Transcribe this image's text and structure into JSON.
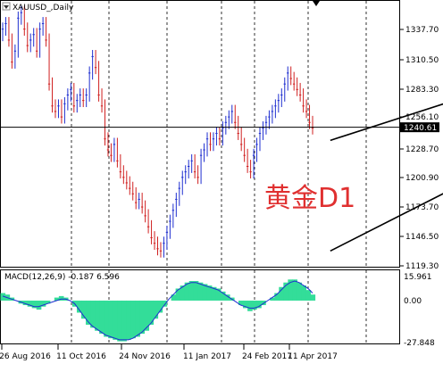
{
  "chart": {
    "symbol_label": "XAUUSD_,Daily",
    "annotation": "黄金D1",
    "current_price": "1240.61",
    "price_axis": [
      "1337.70",
      "1310.50",
      "1283.30",
      "1256.10",
      "1228.70",
      "1200.90",
      "1173.70",
      "1146.50",
      "1119.30"
    ],
    "time_axis": [
      "26 Aug 2016",
      "11 Oct 2016",
      "24 Nov 2016",
      "11 Jan 2017",
      "24 Feb 2017",
      "11 Apr 2017"
    ],
    "macd_label": "MACD(12,26,9) -0.187 6.596",
    "macd_axis": [
      "15.961",
      "0.00",
      "-27.848"
    ],
    "colors": {
      "background": "#ffffff",
      "candles": "#1f2fd0",
      "candles_bear": "#d02020",
      "annotation": "#e03030",
      "macd_histogram": "#33dd99",
      "macd_signal": "#1f2fd0",
      "grid": "#000000"
    }
  },
  "chart_data": {
    "type": "candlestick",
    "instrument": "XAUUSD",
    "timeframe": "Daily",
    "ylim": [
      1119.3,
      1350
    ],
    "x_start": "2016-07-20",
    "close": [
      1330,
      1335,
      1320,
      1300,
      1310,
      1340,
      1345,
      1330,
      1315,
      1320,
      1325,
      1310,
      1330,
      1335,
      1320,
      1280,
      1260,
      1255,
      1260,
      1250,
      1262,
      1270,
      1275,
      1260,
      1265,
      1270,
      1265,
      1270,
      1290,
      1305,
      1295,
      1270,
      1260,
      1230,
      1220,
      1215,
      1225,
      1210,
      1200,
      1195,
      1190,
      1185,
      1180,
      1172,
      1175,
      1168,
      1160,
      1150,
      1140,
      1135,
      1130,
      1128,
      1135,
      1145,
      1155,
      1165,
      1175,
      1185,
      1195,
      1200,
      1205,
      1210,
      1200,
      1195,
      1215,
      1220,
      1230,
      1225,
      1230,
      1235,
      1230,
      1240,
      1245,
      1250,
      1255,
      1245,
      1235,
      1225,
      1215,
      1205,
      1200,
      1215,
      1225,
      1235,
      1240,
      1245,
      1250,
      1255,
      1260,
      1265,
      1270,
      1280,
      1290,
      1285,
      1280,
      1275,
      1270,
      1260,
      1255,
      1245,
      1240
    ],
    "trend_lines": [
      {
        "name": "channel-upper",
        "from": [
          "2016-12-15",
          1228.7
        ],
        "to": [
          "2017-04-20",
          1310.5
        ]
      },
      {
        "name": "channel-lower",
        "from": [
          "2016-12-15",
          1128.0
        ],
        "to": [
          "2017-04-25",
          1262.0
        ]
      }
    ],
    "horizontal_lines": [
      {
        "name": "current-price-line",
        "y": 1240.61
      }
    ],
    "macd": {
      "params": [
        12,
        26,
        9
      ],
      "value": -0.187,
      "signal": 6.596,
      "ylim": [
        -27.848,
        15.961
      ],
      "histogram": [
        5,
        4,
        2,
        0,
        -2,
        -3,
        -4,
        -5,
        -6,
        -4,
        -2,
        0,
        2,
        3,
        2,
        0,
        -4,
        -8,
        -12,
        -16,
        -18,
        -20,
        -22,
        -24,
        -25,
        -26,
        -27,
        -27,
        -26,
        -25,
        -24,
        -22,
        -20,
        -16,
        -12,
        -8,
        -4,
        0,
        4,
        8,
        10,
        12,
        13,
        13,
        12,
        11,
        10,
        9,
        8,
        6,
        4,
        2,
        0,
        -3,
        -5,
        -7,
        -6,
        -5,
        -3,
        0,
        2,
        5,
        9,
        12,
        14,
        14,
        12,
        10,
        7,
        4
      ],
      "signal_line": [
        3,
        2,
        1,
        0,
        -1,
        -2,
        -3,
        -4,
        -4,
        -3,
        -2,
        -1,
        0,
        1,
        1,
        0,
        -2,
        -6,
        -10,
        -14,
        -17,
        -19,
        -21,
        -23,
        -24,
        -25,
        -26,
        -26,
        -26,
        -25,
        -23,
        -21,
        -18,
        -15,
        -11,
        -7,
        -3,
        1,
        4,
        7,
        9,
        11,
        12,
        12,
        11,
        10,
        9,
        8,
        7,
        5,
        3,
        1,
        -1,
        -3,
        -4,
        -5,
        -5,
        -4,
        -2,
        0,
        2,
        4,
        7,
        10,
        12,
        13,
        12,
        10,
        8,
        5
      ]
    }
  }
}
